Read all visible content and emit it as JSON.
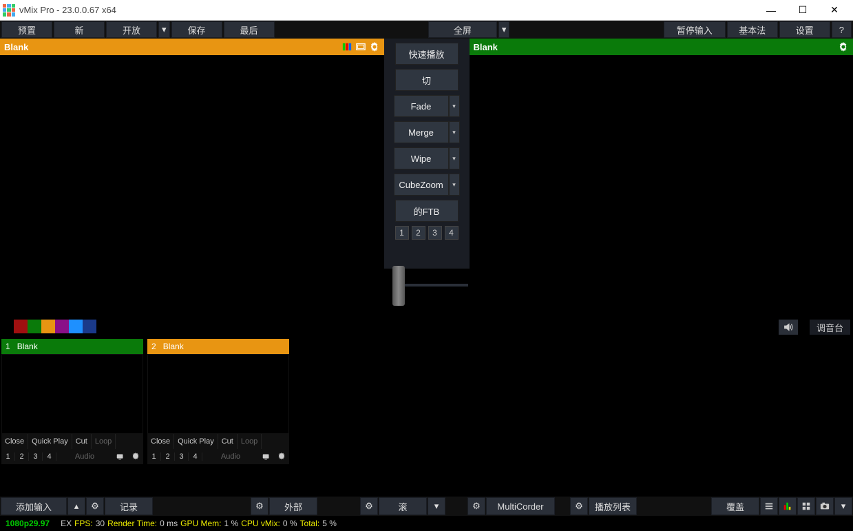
{
  "titlebar": {
    "title": "vMix Pro - 23.0.0.67 x64"
  },
  "toolbar": {
    "preset": "预置",
    "new": "新",
    "open": "开放",
    "save": "保存",
    "last": "最后",
    "fullscreen": "全屏",
    "pause_input": "暂停输入",
    "basic": "基本法",
    "settings": "设置",
    "help": "?"
  },
  "preview": {
    "label": "Blank"
  },
  "program": {
    "label": "Blank"
  },
  "transitions": {
    "quickplay": "快速播放",
    "cut": "切",
    "fade": "Fade",
    "merge": "Merge",
    "wipe": "Wipe",
    "cubezoom": "CubeZoom",
    "ftb": "的FTB",
    "overlays": [
      "1",
      "2",
      "3",
      "4"
    ]
  },
  "color_tabs": [
    "#a01010",
    "#0a7a0a",
    "#e89512",
    "#8a1088",
    "#1e90ff",
    "#1a3a8a"
  ],
  "mixer_label": "调音台",
  "inputs": [
    {
      "num": "1",
      "name": "Blank",
      "color": "green"
    },
    {
      "num": "2",
      "name": "Blank",
      "color": "orange"
    }
  ],
  "input_ctrl": {
    "close": "Close",
    "quickplay": "Quick Play",
    "cut": "Cut",
    "loop": "Loop",
    "nums": [
      "1",
      "2",
      "3",
      "4"
    ],
    "audio": "Audio"
  },
  "bottom": {
    "add_input": "添加输入",
    "record": "记录",
    "external": "外部",
    "stream": "滚",
    "multicorder": "MultiCorder",
    "playlist": "播放列表",
    "overlay": "覆盖"
  },
  "status": {
    "format": "1080p29.97",
    "ex": "EX",
    "fps_l": "FPS:",
    "fps_v": "30",
    "rt_l": "Render Time:",
    "rt_v": "0 ms",
    "gpu_l": "GPU Mem:",
    "gpu_v": "1 %",
    "cpu_l": "CPU vMix:",
    "cpu_v": "0 %",
    "tot_l": "Total:",
    "tot_v": "5 %"
  }
}
